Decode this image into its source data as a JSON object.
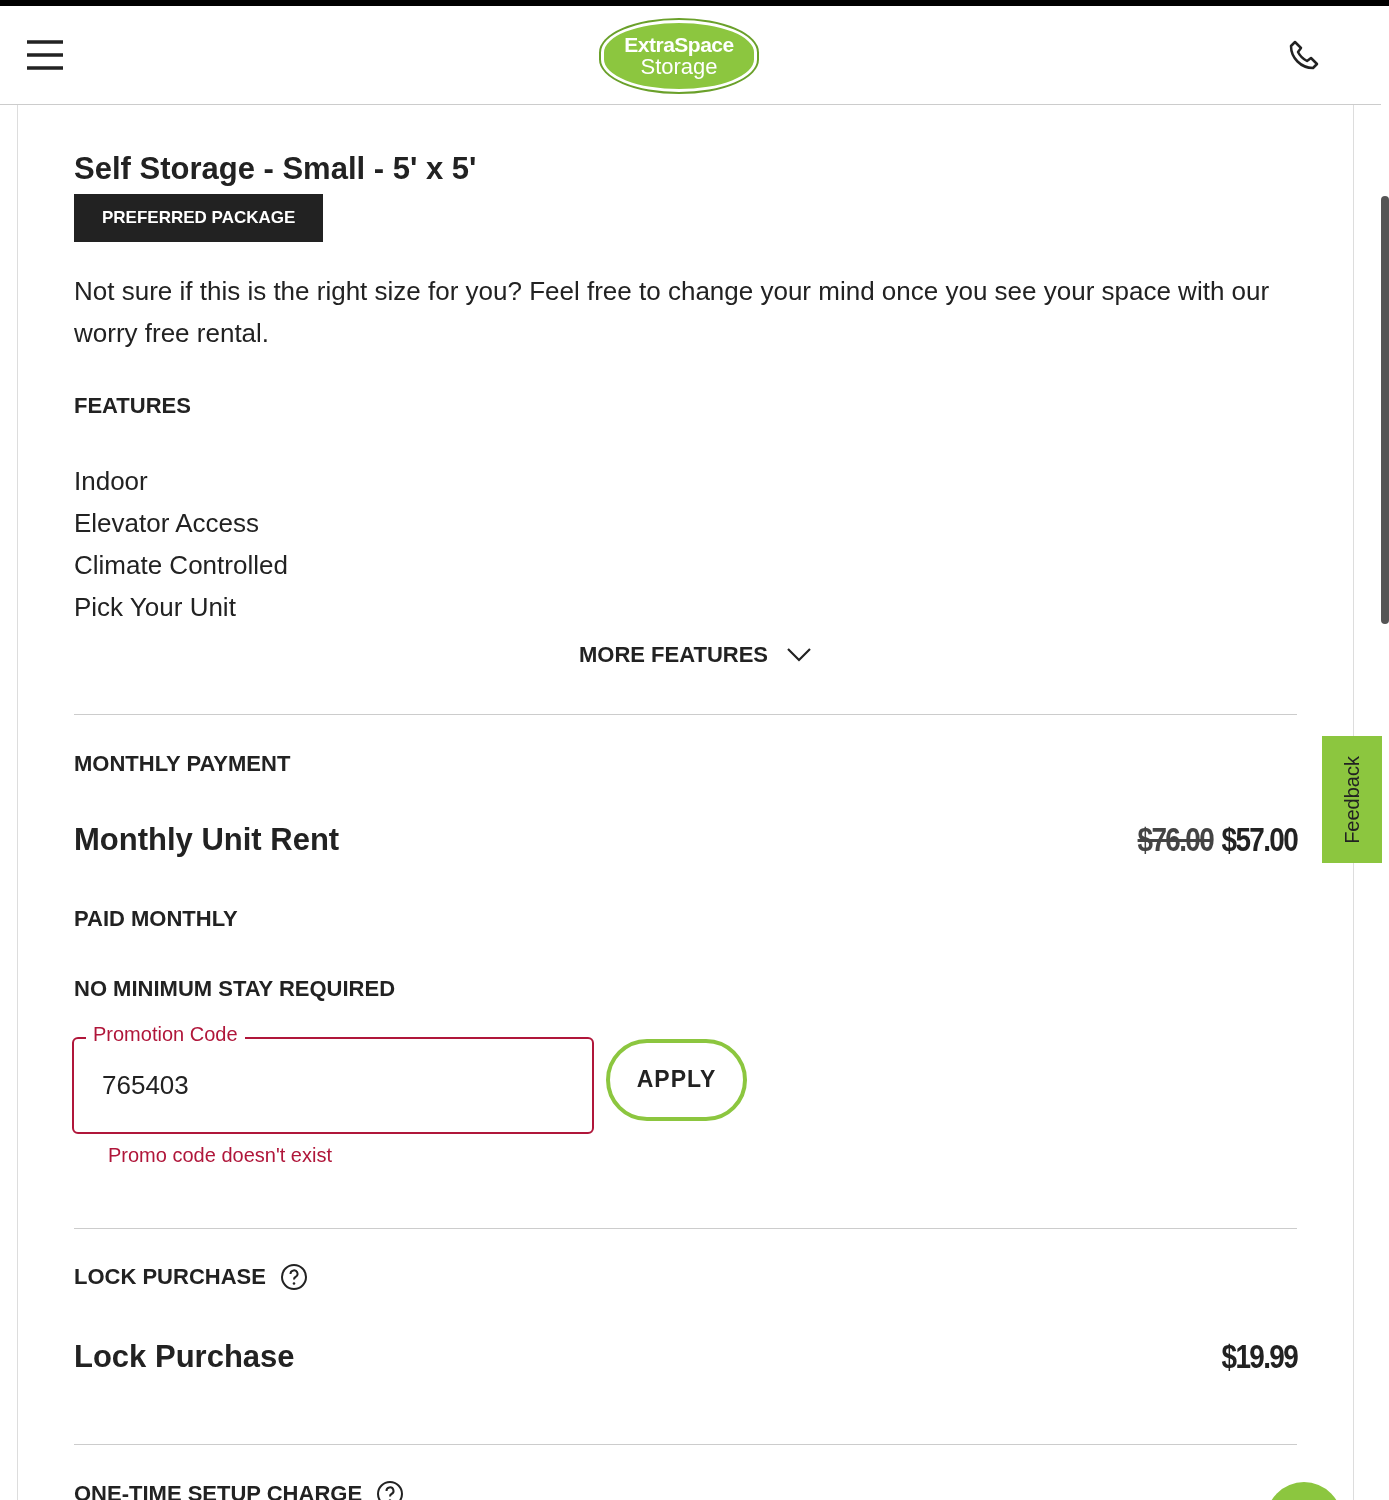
{
  "header": {
    "logo": {
      "line1": "ExtraSpace",
      "line2": "Storage"
    }
  },
  "unit": {
    "title": "Self Storage - Small - 5' x 5'",
    "badge": "PREFERRED PACKAGE",
    "description": "Not sure if this is the right size for you? Feel free to change your mind once you see your space with our worry free rental.",
    "features_heading": "FEATURES",
    "features": [
      "Indoor",
      "Elevator Access",
      "Climate Controlled",
      "Pick Your Unit"
    ],
    "more_features": {
      "label": "MORE FEATURES",
      "expanded": false
    }
  },
  "monthly": {
    "heading": "MONTHLY PAYMENT",
    "rent_label": "Monthly Unit Rent",
    "original_price": "$76.00",
    "price": "$57.00",
    "paid": "PAID MONTHLY",
    "no_minimum": "NO MINIMUM STAY REQUIRED"
  },
  "promo": {
    "label": "Promotion Code",
    "value": "765403",
    "invalid": true,
    "error": "Promo code doesn't exist",
    "apply": "APPLY"
  },
  "lock": {
    "heading": "LOCK PURCHASE",
    "label": "Lock Purchase",
    "price": "$19.99"
  },
  "setup": {
    "heading": "ONE-TIME SETUP CHARGE"
  },
  "feedback": "Feedback"
}
